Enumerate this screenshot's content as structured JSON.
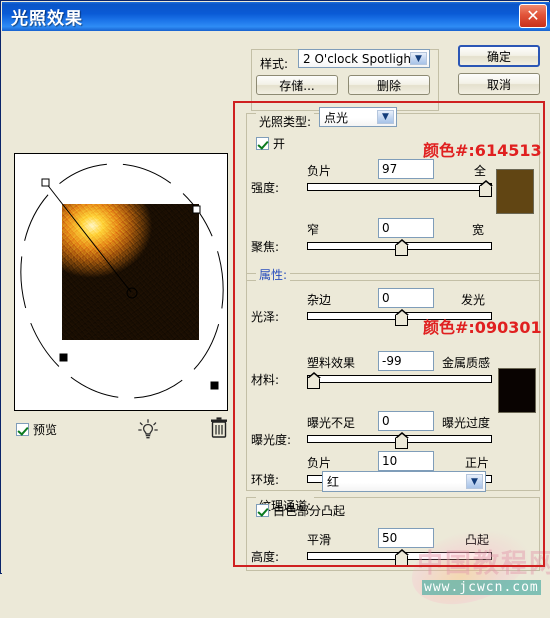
{
  "window": {
    "title": "光照效果",
    "close_label": "✕"
  },
  "style_group": {
    "label": "样式:",
    "selected": "2 O'clock Spotlight",
    "save_label": "存储...",
    "delete_label": "删除"
  },
  "action_buttons": {
    "ok": "确定",
    "cancel": "取消"
  },
  "preview": {
    "checkbox_label": "预览",
    "bulb_icon": "light-bulb-icon",
    "trash_icon": "trash-can-icon"
  },
  "light_type_group": {
    "label": "光照类型:",
    "selected": "点光",
    "on_label": "开",
    "intensity": {
      "label": "强度:",
      "min_label": "负片",
      "max_label": "全",
      "value": "97",
      "percent": 97
    },
    "focus": {
      "label": "聚焦:",
      "min_label": "窄",
      "max_label": "宽",
      "value": "0",
      "percent": 50
    },
    "color_annotation": "颜色#:614513",
    "color_hex": "#614513"
  },
  "properties_group": {
    "label": "属性:",
    "gloss": {
      "label": "光泽:",
      "min_label": "杂边",
      "max_label": "发光",
      "value": "0",
      "percent": 50
    },
    "material": {
      "label": "材料:",
      "min_label": "塑料效果",
      "max_label": "金属质感",
      "value": "-99",
      "percent": 1
    },
    "exposure": {
      "label": "曝光度:",
      "min_label": "曝光不足",
      "max_label": "曝光过度",
      "value": "0",
      "percent": 50
    },
    "ambience": {
      "label": "环境:",
      "min_label": "负片",
      "max_label": "正片",
      "value": "10",
      "percent": 55
    },
    "color_annotation": "颜色#:090301",
    "color_hex": "#090301"
  },
  "texture_group": {
    "label": "纹理通道:",
    "selected": "红",
    "white_is_high_label": "白色部分凸起",
    "height": {
      "label": "高度:",
      "min_label": "平滑",
      "max_label": "凸起",
      "value": "50",
      "percent": 50
    }
  },
  "watermark": {
    "site_name": "中国教程网",
    "url": "www.jcwcn.com"
  }
}
